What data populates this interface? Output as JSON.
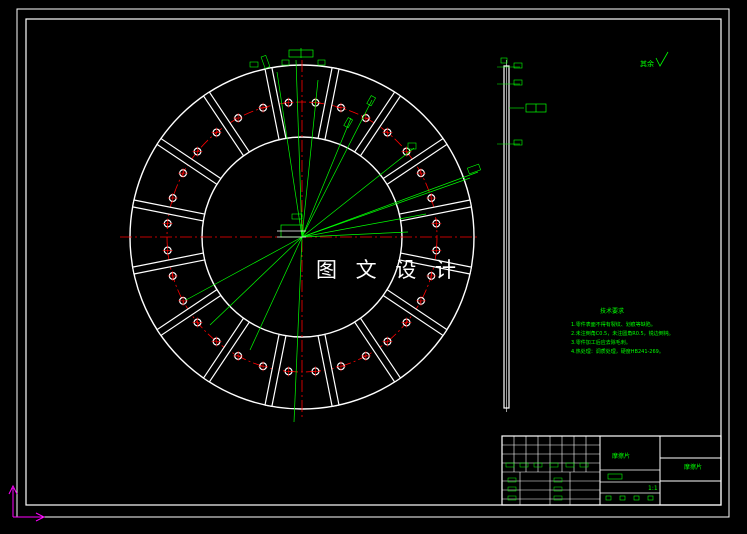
{
  "watermark": "图 文 设 计",
  "roughness_symbol": "其余",
  "tech_requirements": {
    "title": "技术要求",
    "items": [
      "1.零件表面不得有裂纹、划痕等缺陷。",
      "2.未注倒角C0.5，未注圆角R0.5，锐边倒钝。",
      "3.零件加工后应去除毛刺。",
      "4.热处理：调质处理，硬度HB241-269。"
    ]
  },
  "title_block": {
    "part_name": "摩擦片",
    "drawing_no": "摩擦片",
    "scale": "1:1"
  },
  "colors": {
    "background": "#000000",
    "frame": "#ffffff",
    "dimension": "#00ff00",
    "centerline": "#ff0000"
  }
}
